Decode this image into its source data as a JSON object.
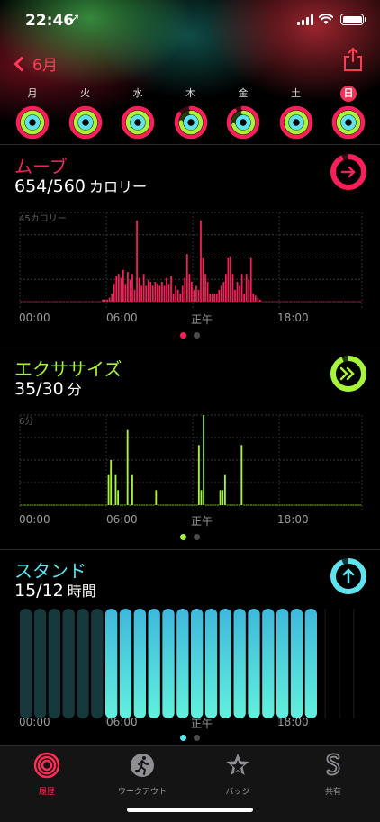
{
  "status_bar": {
    "time": "22:46",
    "location_glyph": "➚"
  },
  "nav": {
    "back_label": "6月"
  },
  "week": {
    "days": [
      {
        "label": "月",
        "move": 1.15,
        "exercise": 1.0,
        "stand": 1.0,
        "selected": false
      },
      {
        "label": "火",
        "move": 1.1,
        "exercise": 1.0,
        "stand": 1.0,
        "selected": false
      },
      {
        "label": "水",
        "move": 1.05,
        "exercise": 1.0,
        "stand": 1.0,
        "selected": false
      },
      {
        "label": "木",
        "move": 0.85,
        "exercise": 0.75,
        "stand": 1.0,
        "selected": false
      },
      {
        "label": "金",
        "move": 0.9,
        "exercise": 0.7,
        "stand": 1.0,
        "selected": false
      },
      {
        "label": "土",
        "move": 1.05,
        "exercise": 1.0,
        "stand": 1.0,
        "selected": false
      },
      {
        "label": "日",
        "move": 1.17,
        "exercise": 1.17,
        "stand": 1.25,
        "selected": true
      }
    ]
  },
  "move": {
    "title": "ムーブ",
    "value": "654/560",
    "unit": "カロリー",
    "max_label": "45カロリー",
    "color": "#fa1e5a"
  },
  "exercise": {
    "title": "エクササイズ",
    "value": "35/30",
    "unit": "分",
    "max_label": "6分",
    "color": "#a7f53a"
  },
  "stand": {
    "title": "スタンド",
    "value": "15/12",
    "unit": "時間",
    "color": "#5ee3ee"
  },
  "axis": {
    "t0": "00:00",
    "t1": "06:00",
    "t2": "正午",
    "t3": "18:00"
  },
  "chart_data": [
    {
      "type": "bar",
      "title": "ムーブ",
      "ylabel": "45カロリー",
      "x_ticks": [
        "00:00",
        "06:00",
        "正午",
        "18:00"
      ],
      "ylim": [
        0,
        45
      ],
      "minutes": 1440,
      "bucket_minutes": 10,
      "values": [
        0,
        0,
        0,
        0,
        0,
        0,
        0,
        0,
        0,
        0,
        0,
        0,
        0,
        0,
        0,
        0,
        0,
        0,
        0,
        0,
        0,
        0,
        0,
        0,
        0,
        0,
        0,
        0,
        0,
        0,
        0,
        0,
        0,
        0,
        0,
        0,
        1,
        1,
        1,
        2,
        4,
        9,
        13,
        14,
        12,
        16,
        9,
        15,
        11,
        14,
        6,
        41,
        12,
        8,
        14,
        8,
        11,
        10,
        8,
        10,
        9,
        8,
        10,
        8,
        12,
        9,
        13,
        4,
        8,
        6,
        4,
        8,
        12,
        24,
        14,
        10,
        6,
        8,
        6,
        41,
        22,
        14,
        10,
        4,
        4,
        4,
        4,
        6,
        8,
        10,
        14,
        22,
        23,
        14,
        6,
        10,
        8,
        14,
        4,
        14,
        11,
        22,
        4,
        3,
        2,
        1,
        0,
        0,
        0,
        0,
        0,
        0,
        0,
        0,
        0,
        0,
        0,
        0,
        0,
        0,
        0,
        0,
        0,
        0,
        0,
        0,
        0,
        0,
        0,
        0,
        0,
        0,
        0,
        0,
        0,
        0,
        0,
        0,
        0,
        0,
        0,
        0,
        0,
        0,
        0,
        0,
        0,
        0,
        0,
        0
      ],
      "series": [
        {
          "name": "ムーブ"
        }
      ]
    },
    {
      "type": "bar",
      "title": "エクササイズ",
      "ylabel": "6分",
      "x_ticks": [
        "00:00",
        "06:00",
        "正午",
        "18:00"
      ],
      "ylim": [
        0,
        6
      ],
      "values_by_bucket": {
        "37": 2.0,
        "38": 3.0,
        "40": 2.0,
        "41": 1.0,
        "45": 5.0,
        "47": 2.0,
        "57": 1.0,
        "75": 4.0,
        "76": 1.0,
        "77": 6.0,
        "84": 1.0,
        "85": 1.0,
        "86": 2.0,
        "93": 4.0
      },
      "series": [
        {
          "name": "エクササイズ"
        }
      ]
    },
    {
      "type": "bar",
      "title": "スタンド",
      "x_ticks": [
        "00:00",
        "06:00",
        "正午",
        "18:00"
      ],
      "hours": [
        0,
        0,
        0,
        0,
        0,
        0,
        1,
        1,
        1,
        1,
        1,
        1,
        1,
        1,
        1,
        1,
        1,
        1,
        1,
        1,
        1,
        0,
        0,
        0
      ],
      "series": [
        {
          "name": "スタンド"
        }
      ]
    }
  ],
  "tabs": [
    {
      "label": "履歴",
      "icon": "activity-rings-icon",
      "active": true
    },
    {
      "label": "ワークアウト",
      "icon": "runner-icon",
      "active": false
    },
    {
      "label": "バッジ",
      "icon": "badge-star-icon",
      "active": false
    },
    {
      "label": "共有",
      "icon": "share-s-icon",
      "active": false
    }
  ]
}
